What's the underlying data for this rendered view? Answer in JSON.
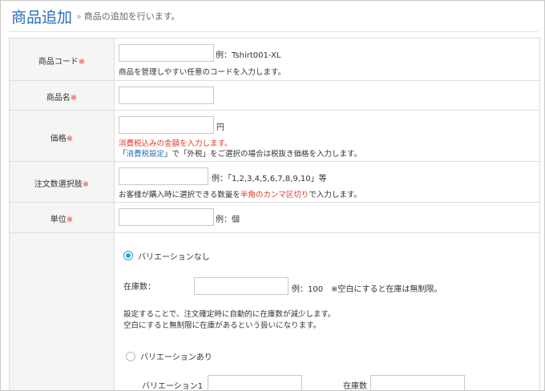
{
  "header": {
    "title": "商品追加",
    "raquo": "»",
    "subtitle": "商品の追加を行います。"
  },
  "required_mark": "※",
  "fields": {
    "code": {
      "label": "商品コード",
      "example": "例：Tshirt001-XL",
      "help": "商品を管理しやすい任意のコードを入力します。"
    },
    "name": {
      "label": "商品名"
    },
    "price": {
      "label": "価格",
      "unit": "円",
      "warning": "消費税込みの金額を入力します。",
      "help_open": "「",
      "help_link": "消費税設定",
      "help_close": "」で「外税」をご選択の場合は税抜き価格を入力します。"
    },
    "quantity_options": {
      "label": "注文数選択肢",
      "example": "例：「1,2,3,4,5,6,7,8,9,10」等",
      "help_pre": "お客様が購入時に選択できる数量を",
      "help_highlight": "半角のカンマ区切り",
      "help_post": "で入力します。"
    },
    "unit": {
      "label": "単位",
      "example": "例：個"
    },
    "variation": {
      "option_none": "バリエーションなし",
      "stock_label": "在庫数：",
      "stock_example": "例：100",
      "stock_note": "※空白にすると在庫は無制限。",
      "help_line1": "設定することで、注文確定時に自動的に在庫数が減少します。",
      "help_line2": "空白にすると無制限に在庫があるという扱いになります。",
      "option_with": "バリエーションあり",
      "variation1_label": "バリエーション1",
      "stock2_label": "在庫数"
    }
  }
}
